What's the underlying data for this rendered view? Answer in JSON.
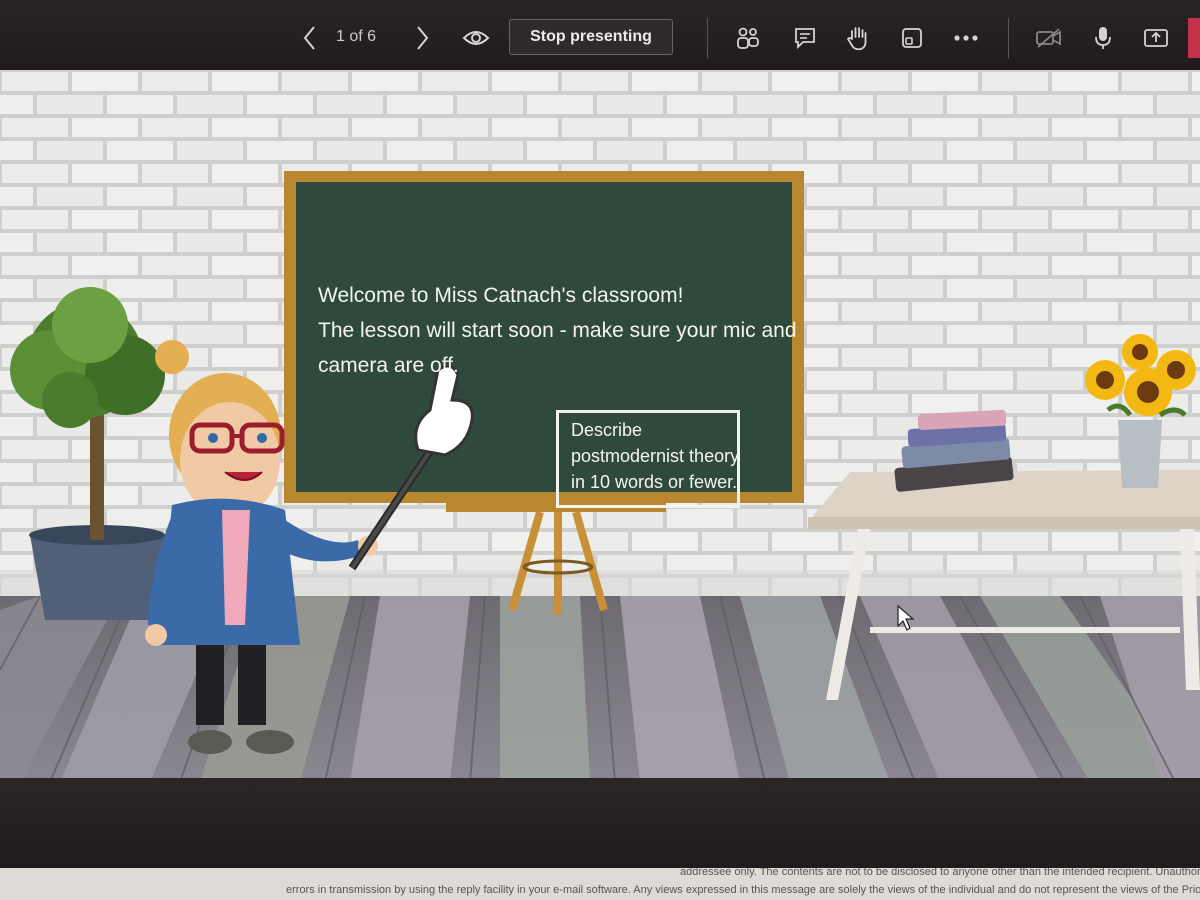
{
  "toolbar": {
    "page_indicator": "1 of 6",
    "stop_presenting_label": "Stop presenting",
    "icons": [
      "chevron-left-icon",
      "chevron-right-icon",
      "eye-icon",
      "people-icon",
      "chat-icon",
      "raise-hand-icon",
      "reactions-icon",
      "more-icon",
      "camera-off-icon",
      "mic-icon",
      "share-icon"
    ]
  },
  "slide": {
    "board_lines": [
      "Welcome to Miss Catnach's classroom!",
      "The lesson will start soon - make sure your mic and",
      "camera are off."
    ],
    "question_lines": [
      "Describe",
      "postmodernist theory",
      "in 10 words or fewer."
    ]
  },
  "email_strip": {
    "line1": "addressee only. The contents are not to be disclosed to anyone other than the intended recipient. Unauthorised rec",
    "line2": "errors in transmission by using the reply facility in your e-mail software. Any views expressed in this message are solely the views of the individual and do not represent the views of the Priory Federati"
  },
  "colors": {
    "toolbar_bg": "#231f21",
    "chalkboard": "#2f4a3c",
    "board_frame": "#b8872f",
    "wall": "#e9e9e7"
  }
}
